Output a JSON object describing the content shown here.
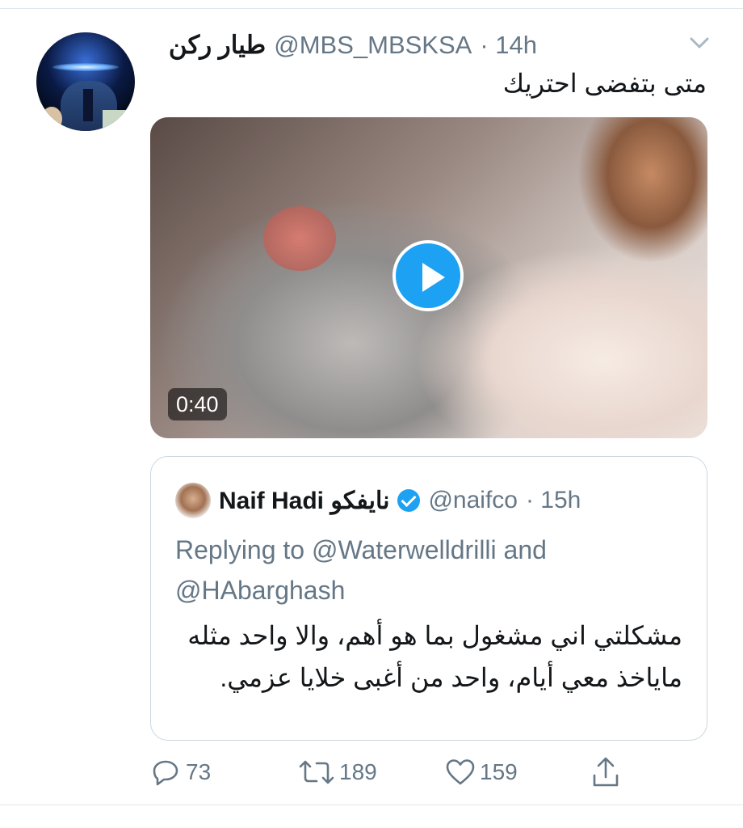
{
  "tweet": {
    "display_name": "طيار ركن",
    "handle": "@MBS_MBSKSA",
    "time": "· 14h",
    "text": "متى بتفضى احتريك",
    "video_duration": "0:40"
  },
  "quoted_tweet": {
    "display_name": "Naif Hadi نايفكو",
    "handle": "@naifco",
    "time": "· 15h",
    "replying_to": "Replying to @Waterwelldrilli and @HAbarghash",
    "text": "مشكلتي اني مشغول بما هو أهم، والا واحد مثله مايا‌خذ معي أيام، واحد من أغبى خلايا عزمي."
  },
  "actions": {
    "reply_count": "73",
    "retweet_count": "189",
    "like_count": "159"
  },
  "icons": [
    "chevron-down-icon",
    "play-icon",
    "verified-icon",
    "reply-icon",
    "retweet-icon",
    "like-icon",
    "share-icon"
  ],
  "colors": {
    "accent": "#1da1f2",
    "secondary_text": "#657786",
    "border": "#ccd6dd"
  }
}
